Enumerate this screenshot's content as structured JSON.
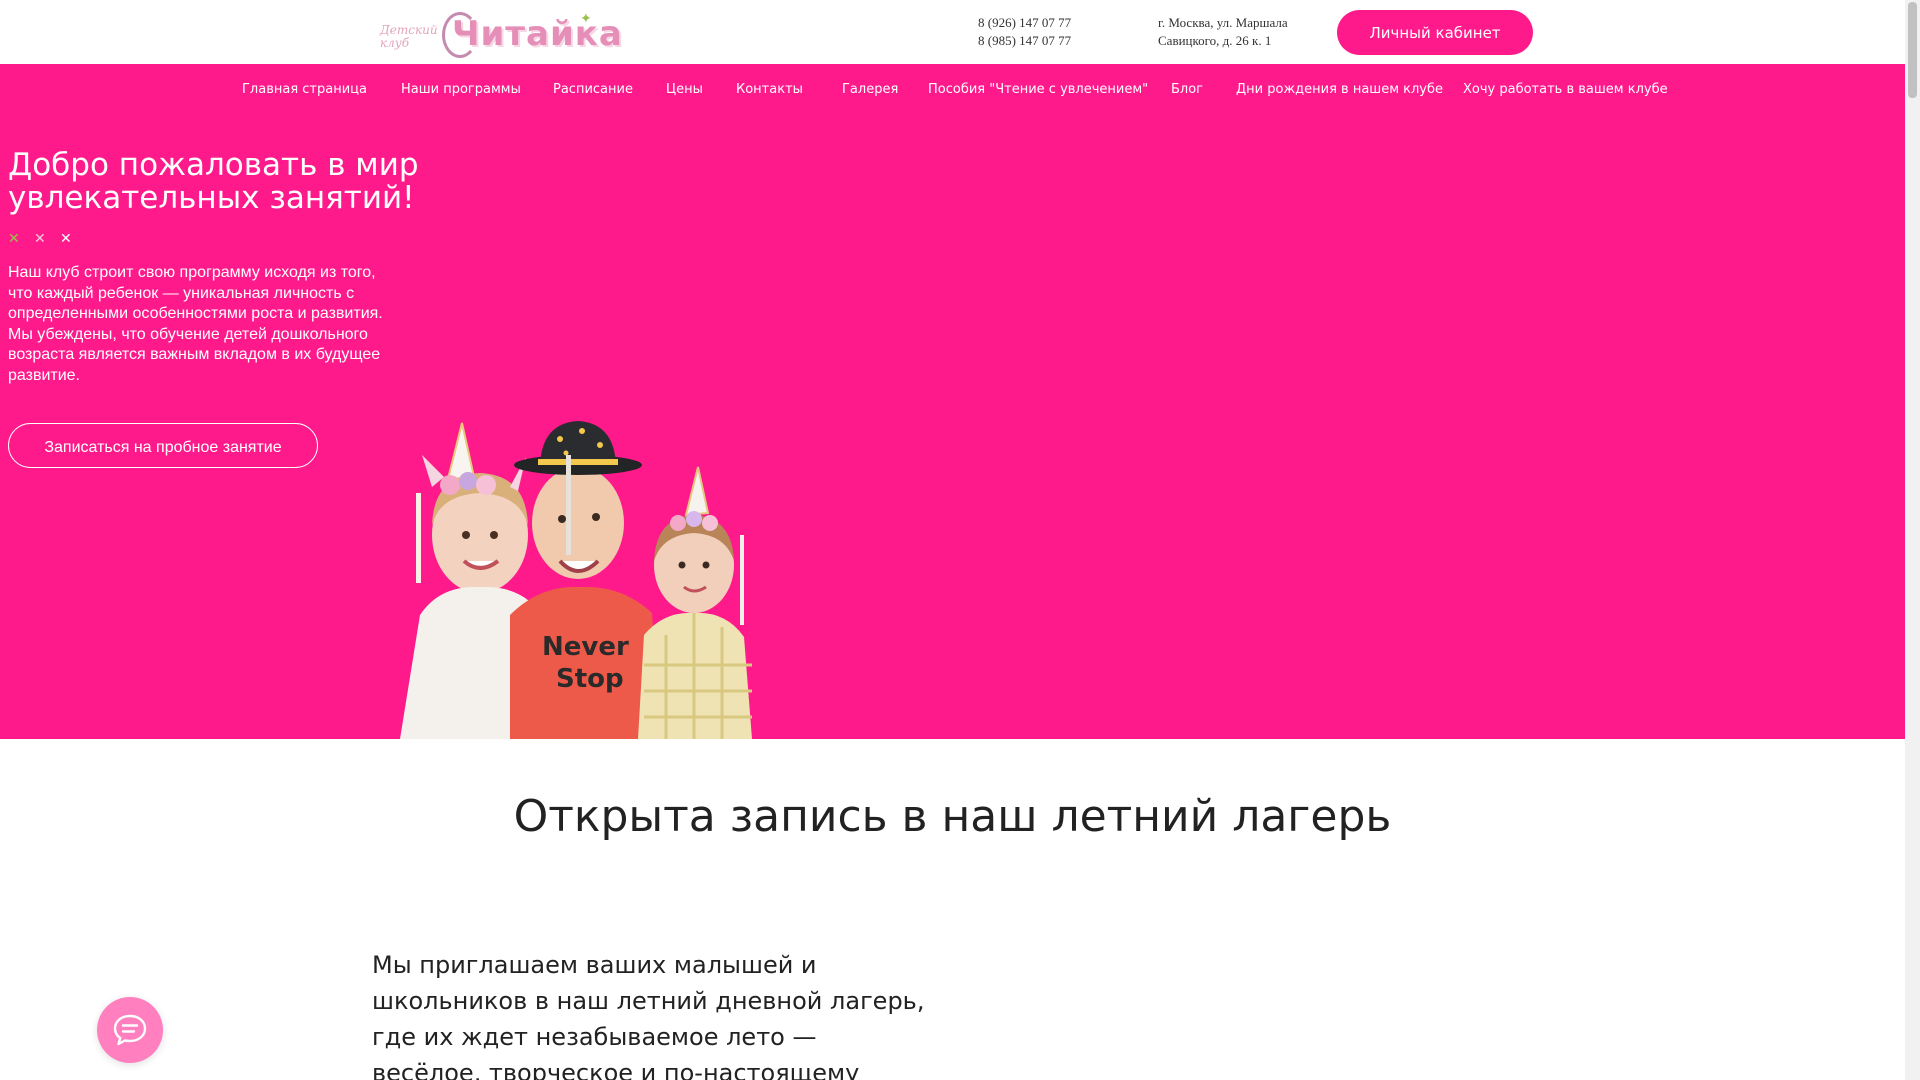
{
  "header": {
    "logo": {
      "small_text": "Детский клуб",
      "main_text": "Читайка"
    },
    "phones": [
      "8 (926) 147 07 77",
      "8 (985) 147 07 77"
    ],
    "address": [
      "г. Москва, ул. Маршала",
      "Савицкого, д. 26 к. 1"
    ],
    "account_button": "Личный кабинет"
  },
  "nav": {
    "items": [
      {
        "label": "Главная страница"
      },
      {
        "label": "Наши программы"
      },
      {
        "label": "Расписание"
      },
      {
        "label": "Цены"
      },
      {
        "label": "Контакты"
      },
      {
        "label": "Галерея"
      },
      {
        "label": "Пособия \"Чтение с увлечением\""
      },
      {
        "label": "Блог"
      },
      {
        "label": "Дни рождения в нашем клубе"
      },
      {
        "label": "Хочу работать в вашем клубе"
      }
    ]
  },
  "hero": {
    "title": "Добро пожаловать в мир увлекательных занятий!",
    "decor_colors": [
      "#9ac24a",
      "#f3c9d9",
      "#ffffff"
    ],
    "text": "Наш клуб строит свою программу исходя из того, что каждый ребенок — уникальная личность с определенными особенностями роста и развития. Мы убеждены, что обучение детей дошкольного возраста является важным вкладом в их будущее развитие.",
    "cta_button": "Записаться на пробное занятие",
    "image_alt_icons": [
      "children-photo"
    ]
  },
  "camp": {
    "title": "Открыта запись в наш летний лагерь",
    "text": "Мы приглашаем ваших малышей и школьников в наш летний дневной лагерь, где их ждет незабываемое лето — весёлое, творческое и по-настоящему"
  },
  "colors": {
    "brand_pink": "#ff1a8c",
    "chat_pink": "#ff7fbf"
  },
  "widgets": {
    "chat_icon": "chat-bubble-icon"
  }
}
